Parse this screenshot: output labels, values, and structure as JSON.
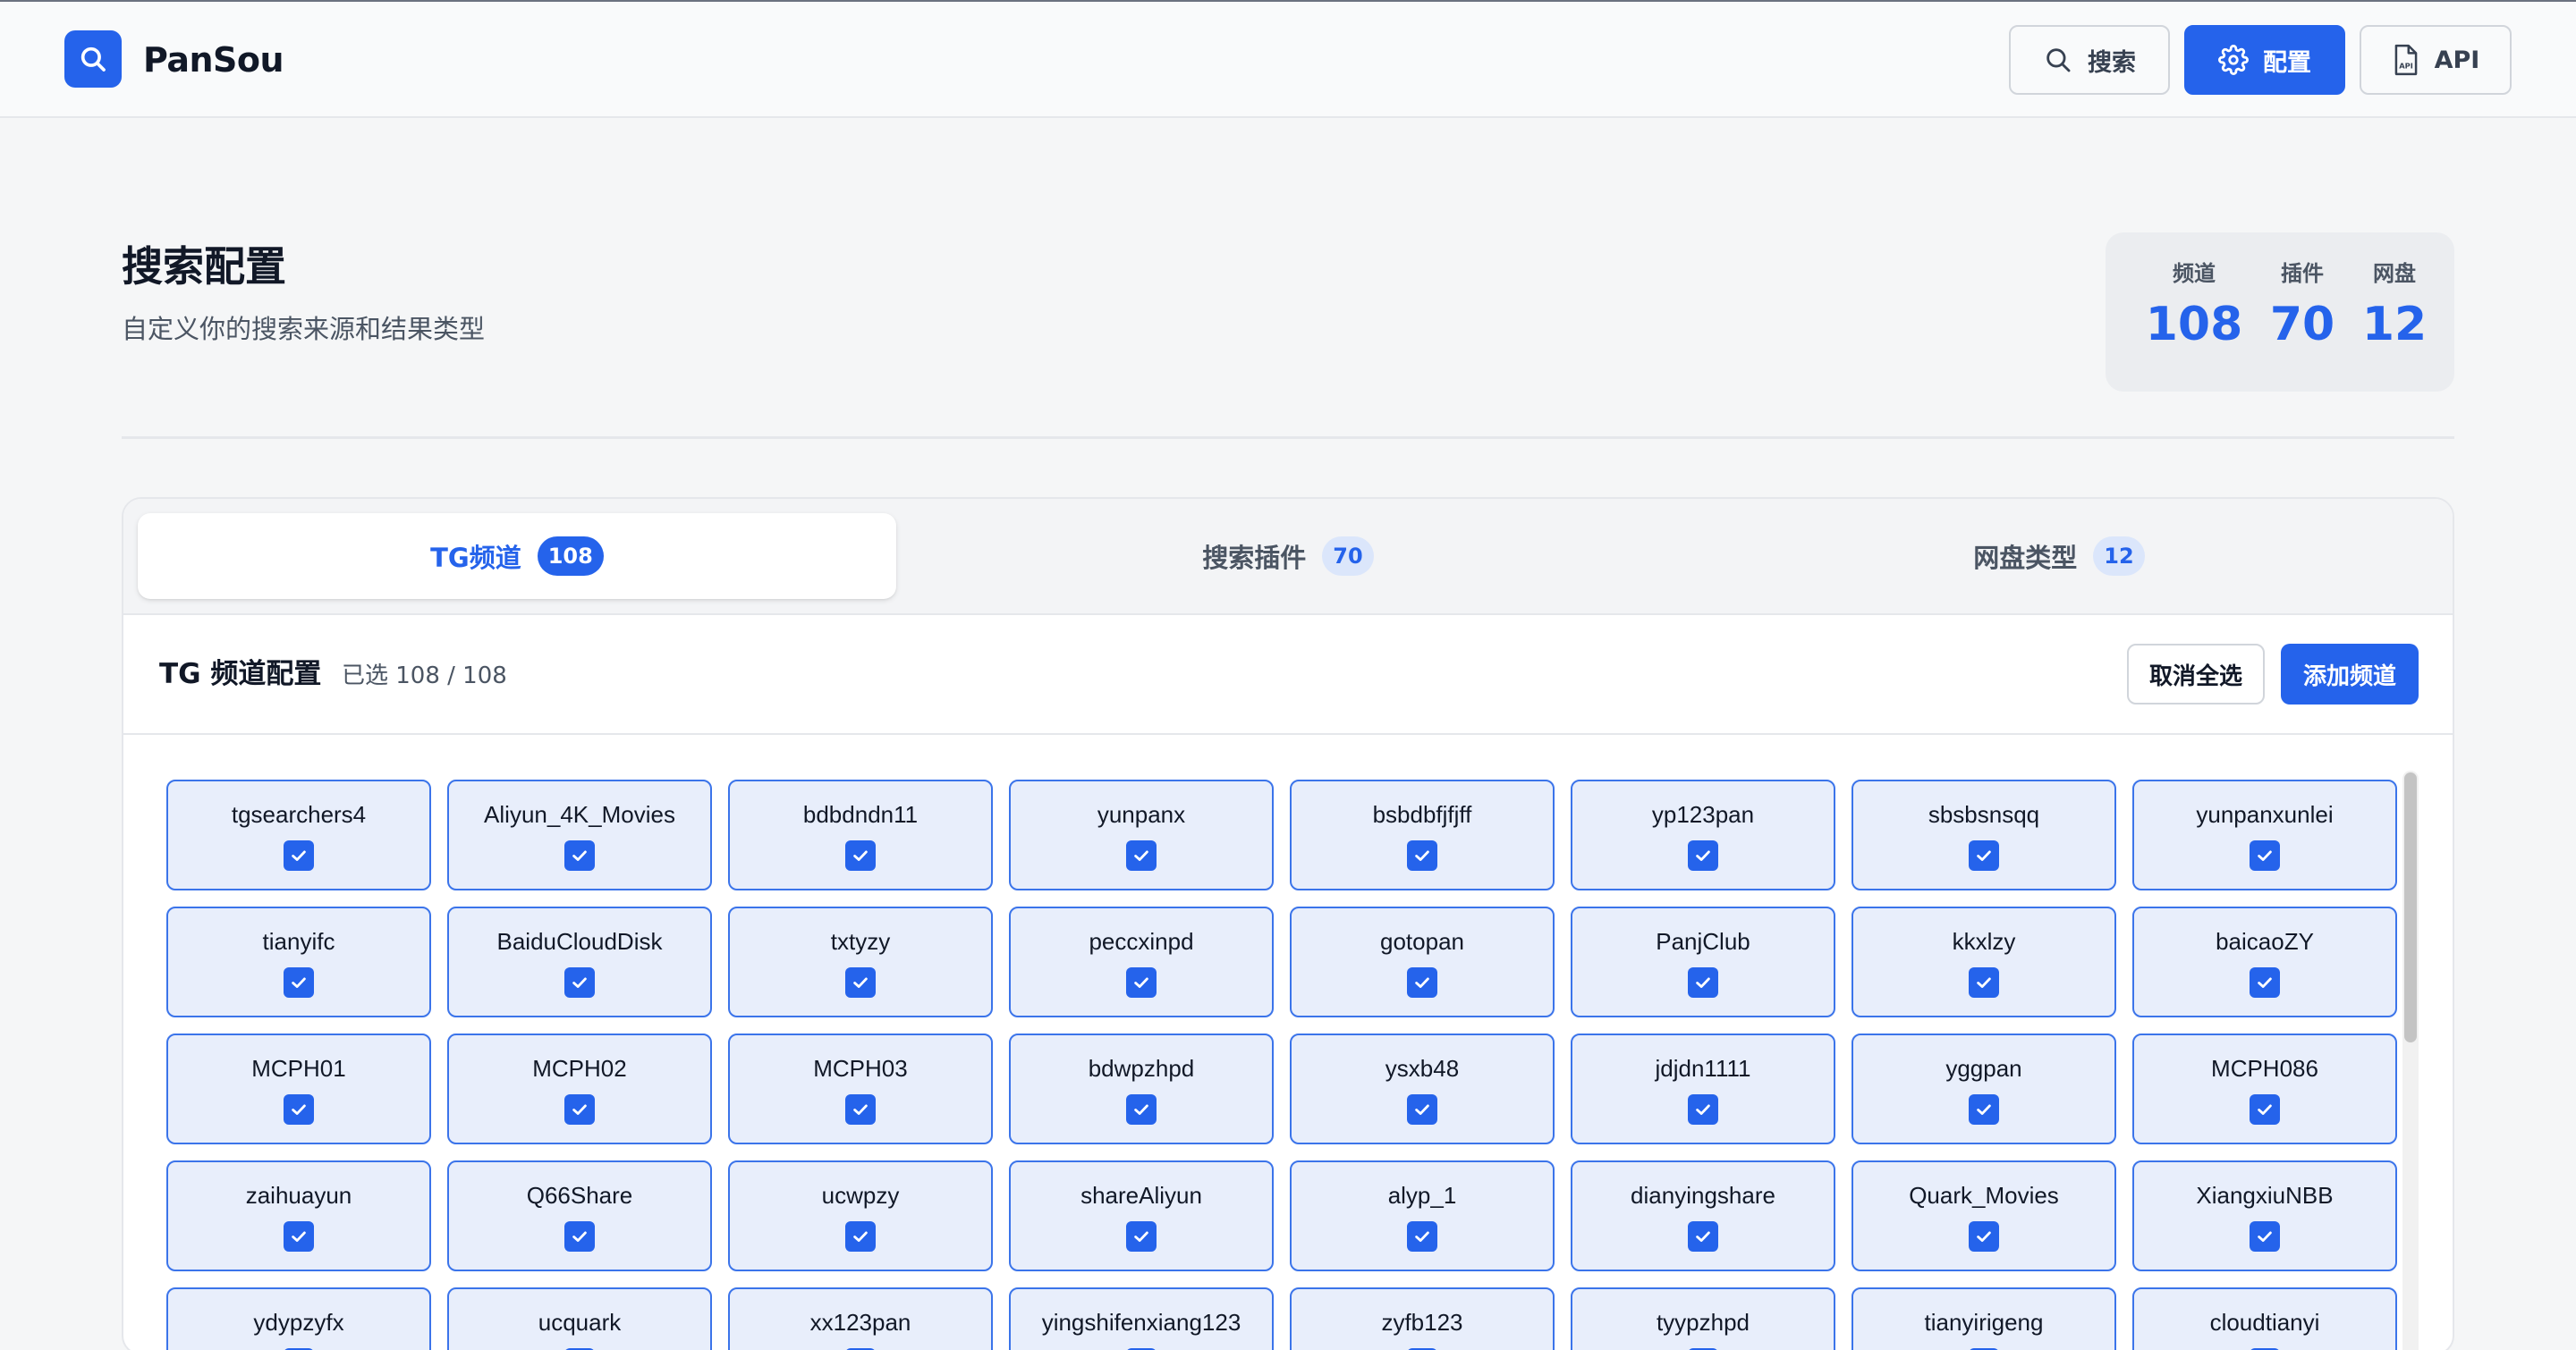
{
  "header": {
    "brand": "PanSou",
    "nav": [
      {
        "label": "搜索",
        "icon": "search-icon"
      },
      {
        "label": "配置",
        "icon": "gear-icon"
      },
      {
        "label": "API",
        "icon": "api-file-icon"
      }
    ]
  },
  "page": {
    "title": "搜索配置",
    "subtitle": "自定义你的搜索来源和结果类型"
  },
  "stats": [
    {
      "label": "频道",
      "value": "108"
    },
    {
      "label": "插件",
      "value": "70"
    },
    {
      "label": "网盘",
      "value": "12"
    }
  ],
  "tabs": [
    {
      "label": "TG频道",
      "count": "108"
    },
    {
      "label": "搜索插件",
      "count": "70"
    },
    {
      "label": "网盘类型",
      "count": "12"
    }
  ],
  "section": {
    "title": "TG 频道配置",
    "selected": "已选 108 / 108",
    "deselect_label": "取消全选",
    "add_label": "添加频道"
  },
  "channels": [
    "tgsearchers4",
    "Aliyun_4K_Movies",
    "bdbdndn11",
    "yunpanx",
    "bsbdbfjfjff",
    "yp123pan",
    "sbsbsnsqq",
    "yunpanxunlei",
    "tianyifc",
    "BaiduCloudDisk",
    "txtyzy",
    "peccxinpd",
    "gotopan",
    "PanjClub",
    "kkxlzy",
    "baicaoZY",
    "MCPH01",
    "MCPH02",
    "MCPH03",
    "bdwpzhpd",
    "ysxb48",
    "jdjdn1111",
    "yggpan",
    "MCPH086",
    "zaihuayun",
    "Q66Share",
    "ucwpzy",
    "shareAliyun",
    "alyp_1",
    "dianyingshare",
    "Quark_Movies",
    "XiangxiuNBB",
    "ydypzyfx",
    "ucquark",
    "xx123pan",
    "yingshifenxiang123",
    "zyfb123",
    "tyypzhpd",
    "tianyirigeng",
    "cloudtianyi"
  ],
  "colors": {
    "accent": "#2563eb",
    "tile_bg": "#e8eefb",
    "tile_border": "#3b74ea",
    "page_bg": "#f5f6f7"
  }
}
